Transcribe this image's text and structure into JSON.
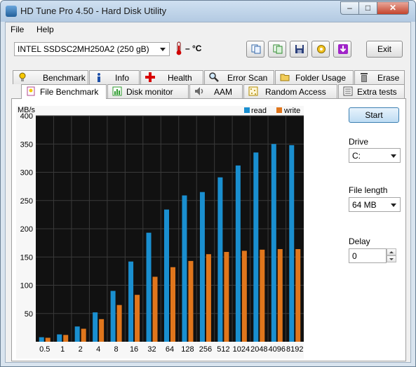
{
  "window": {
    "title": "HD Tune Pro 4.50 - Hard Disk Utility",
    "controls": {
      "minimize": "–",
      "maximize": "□",
      "close": "✕"
    }
  },
  "menu": [
    {
      "label": "File",
      "accel": "F"
    },
    {
      "label": "Help",
      "accel": "H"
    }
  ],
  "toolbar": {
    "drive": "INTEL SSDSC2MH250A2 (250 gB)",
    "temperature": "– °C",
    "buttons": [
      "copy-info-icon",
      "copy-screenshot-icon",
      "save-icon",
      "options-icon",
      "download-icon"
    ],
    "exit_label": "Exit"
  },
  "tabs_top": [
    {
      "label": "Benchmark",
      "icon": "benchmark-icon"
    },
    {
      "label": "Info",
      "icon": "info-icon"
    },
    {
      "label": "Health",
      "icon": "health-icon"
    },
    {
      "label": "Error Scan",
      "icon": "error-scan-icon"
    },
    {
      "label": "Folder Usage",
      "icon": "folder-icon"
    },
    {
      "label": "Erase",
      "icon": "erase-icon"
    }
  ],
  "tabs_bottom": [
    {
      "label": "File Benchmark",
      "icon": "file-benchmark-icon",
      "active": true
    },
    {
      "label": "Disk monitor",
      "icon": "disk-monitor-icon"
    },
    {
      "label": "AAM",
      "icon": "aam-icon"
    },
    {
      "label": "Random Access",
      "icon": "random-access-icon"
    },
    {
      "label": "Extra tests",
      "icon": "extra-tests-icon"
    }
  ],
  "controls": {
    "start_label": "Start",
    "drive_label": "Drive",
    "drive_value": "C:",
    "file_length_label": "File length",
    "file_length_value": "64 MB",
    "delay_label": "Delay",
    "delay_value": "0"
  },
  "colors": {
    "read": "#1a8fd0",
    "write": "#e0761c",
    "plot_bg": "#111111",
    "grid": "#3a3a3a"
  },
  "chart_data": {
    "type": "bar",
    "ylabel": "MB/s",
    "ylim": [
      0,
      400
    ],
    "yticks": [
      50,
      100,
      150,
      200,
      250,
      300,
      350,
      400
    ],
    "categories": [
      "0.5",
      "1",
      "2",
      "4",
      "8",
      "16",
      "32",
      "64",
      "128",
      "256",
      "512",
      "1024",
      "2048",
      "4096",
      "8192"
    ],
    "series": [
      {
        "name": "read",
        "values": [
          8,
          13,
          27,
          52,
          90,
          142,
          193,
          234,
          259,
          265,
          291,
          312,
          335,
          350,
          348
        ]
      },
      {
        "name": "write",
        "values": [
          7,
          12,
          23,
          40,
          65,
          83,
          115,
          132,
          143,
          155,
          159,
          161,
          163,
          164,
          164
        ]
      }
    ],
    "legend_position": "top-right",
    "grid": true
  }
}
